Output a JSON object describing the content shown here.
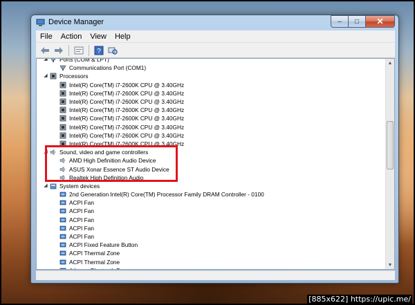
{
  "window": {
    "title": "Device Manager",
    "buttons": {
      "minimize": "–",
      "maximize": "□",
      "close": "✕"
    }
  },
  "menu": [
    "File",
    "Action",
    "View",
    "Help"
  ],
  "toolbar": {
    "icons": [
      "back-arrow-icon",
      "forward-arrow-icon",
      "properties-icon",
      "help-icon",
      "scan-hardware-icon"
    ]
  },
  "tree": [
    {
      "label": "Ports (COM & LPT)",
      "level": 0,
      "expander": "◢",
      "icon": "port-icon"
    },
    {
      "label": "Communications Port (COM1)",
      "level": 1,
      "icon": "port-icon"
    },
    {
      "label": "Processors",
      "level": 0,
      "expander": "◢",
      "icon": "cpu-icon"
    },
    {
      "label": "Intel(R) Core(TM) i7-2600K CPU @ 3.40GHz",
      "level": 1,
      "icon": "cpu-icon"
    },
    {
      "label": "Intel(R) Core(TM) i7-2600K CPU @ 3.40GHz",
      "level": 1,
      "icon": "cpu-icon"
    },
    {
      "label": "Intel(R) Core(TM) i7-2600K CPU @ 3.40GHz",
      "level": 1,
      "icon": "cpu-icon"
    },
    {
      "label": "Intel(R) Core(TM) i7-2600K CPU @ 3.40GHz",
      "level": 1,
      "icon": "cpu-icon"
    },
    {
      "label": "Intel(R) Core(TM) i7-2600K CPU @ 3.40GHz",
      "level": 1,
      "icon": "cpu-icon"
    },
    {
      "label": "Intel(R) Core(TM) i7-2600K CPU @ 3.40GHz",
      "level": 1,
      "icon": "cpu-icon"
    },
    {
      "label": "Intel(R) Core(TM) i7-2600K CPU @ 3.40GHz",
      "level": 1,
      "icon": "cpu-icon"
    },
    {
      "label": "Intel(R) Core(TM) i7-2600K CPU @ 3.40GHz",
      "level": 1,
      "icon": "cpu-icon"
    },
    {
      "label": "Sound, video and game controllers",
      "level": 0,
      "expander": "◢",
      "icon": "speaker-icon"
    },
    {
      "label": "AMD High Definition Audio Device",
      "level": 1,
      "icon": "speaker-icon"
    },
    {
      "label": "ASUS Xonar Essence ST Audio Device",
      "level": 1,
      "icon": "speaker-icon"
    },
    {
      "label": "Realtek High Definition Audio",
      "level": 1,
      "icon": "speaker-icon"
    },
    {
      "label": "System devices",
      "level": 0,
      "expander": "◢",
      "icon": "system-folder-icon"
    },
    {
      "label": "2nd Generation Intel(R) Core(TM) Processor Family DRAM Controller - 0100",
      "level": 1,
      "icon": "system-device-icon"
    },
    {
      "label": "ACPI Fan",
      "level": 1,
      "icon": "system-device-icon"
    },
    {
      "label": "ACPI Fan",
      "level": 1,
      "icon": "system-device-icon"
    },
    {
      "label": "ACPI Fan",
      "level": 1,
      "icon": "system-device-icon"
    },
    {
      "label": "ACPI Fan",
      "level": 1,
      "icon": "system-device-icon"
    },
    {
      "label": "ACPI Fan",
      "level": 1,
      "icon": "system-device-icon"
    },
    {
      "label": "ACPI Fixed Feature Button",
      "level": 1,
      "icon": "system-device-icon"
    },
    {
      "label": "ACPI Thermal Zone",
      "level": 1,
      "icon": "system-device-icon"
    },
    {
      "label": "ACPI Thermal Zone",
      "level": 1,
      "icon": "system-device-icon"
    },
    {
      "label": "Atheros Bluetooth Bus",
      "level": 1,
      "icon": "system-device-icon"
    }
  ],
  "scrollbar": {
    "up": "▲",
    "down": "▼"
  },
  "highlight_color": "#e0141c",
  "footer": "[885x622] https://upic.me/"
}
